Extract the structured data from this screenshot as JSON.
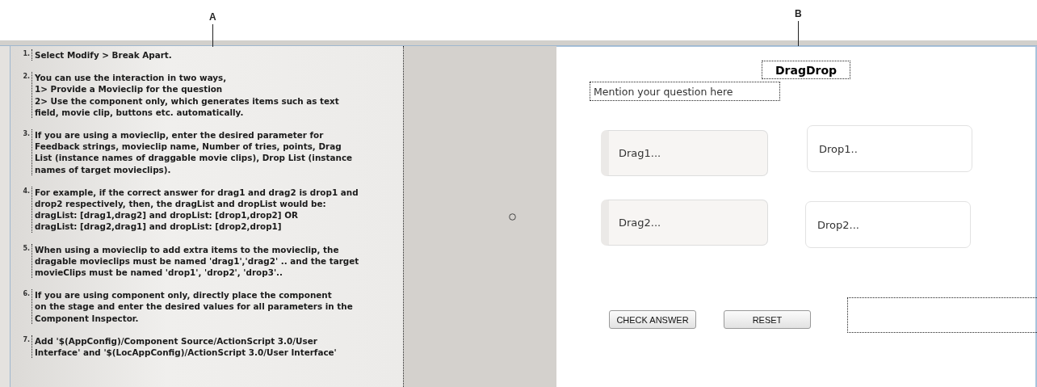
{
  "callouts": [
    {
      "label": "A"
    },
    {
      "label": "B"
    }
  ],
  "instructions": [
    {
      "number": "1.",
      "lines": [
        "Select Modify > Break Apart."
      ]
    },
    {
      "number": "2.",
      "lines": [
        "You can use the interaction in two ways,",
        "1> Provide a Movieclip for the question",
        "2> Use the component only, which generates items such as text",
        "field, movie clip, buttons etc. automatically."
      ]
    },
    {
      "number": "3.",
      "lines": [
        "If you are using a movieclip, enter the desired parameter for",
        "Feedback strings, movieclip name, Number of tries, points, Drag",
        "List (instance names of draggable movie clips), Drop List (instance",
        "names of target movieclips)."
      ]
    },
    {
      "number": "4.",
      "lines": [
        "For example, if the correct answer for drag1 and drag2 is drop1 and",
        "drop2 respectively, then, the dragList and dropList would be:",
        "dragList: [drag1,drag2] and dropList: [drop1,drop2]  OR",
        "dragList: [drag2,drag1] and dropList: [drop2,drop1]"
      ]
    },
    {
      "number": "5.",
      "lines": [
        "When using a movieclip to add extra items to the movieclip, the",
        "dragable movieclips must be named 'drag1','drag2' .. and  the target",
        "movieClips must be named 'drop1', 'drop2', 'drop3'.."
      ]
    },
    {
      "number": "6.",
      "lines": [
        "If you are using component only, directly place the component",
        "on the stage and enter the desired values for all parameters in the",
        "Component Inspector."
      ]
    },
    {
      "number": "7.",
      "lines": [
        "Add '$(AppConfig)/Component Source/ActionScript 3.0/User",
        "Interface' and '$(LocAppConfig)/ActionScript 3.0/User Interface'"
      ]
    }
  ],
  "stage": {
    "title": "DragDrop",
    "question": "Mention your question here",
    "drag_items": [
      {
        "label": "Drag1..."
      },
      {
        "label": "Drag2..."
      }
    ],
    "drop_targets": [
      {
        "label": "Drop1.."
      },
      {
        "label": "Drop2..."
      }
    ],
    "buttons": [
      {
        "label": "CHECK ANSWER"
      },
      {
        "label": "RESET"
      }
    ]
  }
}
